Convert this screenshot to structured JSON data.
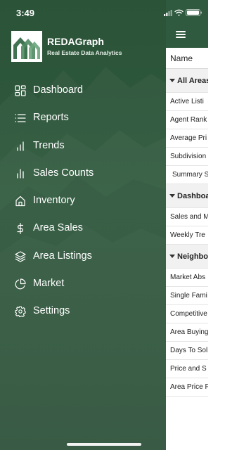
{
  "status_bar": {
    "time": "3:49"
  },
  "brand": {
    "name": "REDAGraph",
    "tagline": "Real Estate Data Analytics"
  },
  "menu": [
    {
      "label": "Dashboard",
      "icon": "dashboard-grid-icon"
    },
    {
      "label": "Reports",
      "icon": "list-icon"
    },
    {
      "label": "Trends",
      "icon": "bar-chart-icon"
    },
    {
      "label": "Sales Counts",
      "icon": "bar-chart-alt-icon"
    },
    {
      "label": "Inventory",
      "icon": "home-icon"
    },
    {
      "label": "Area Sales",
      "icon": "dollar-icon"
    },
    {
      "label": "Area Listings",
      "icon": "layers-icon"
    },
    {
      "label": "Market",
      "icon": "pie-chart-icon"
    },
    {
      "label": "Settings",
      "icon": "gear-icon"
    }
  ],
  "background_panel": {
    "column_header": "Name",
    "groups": [
      {
        "title": "All Areas",
        "rows": [
          "Active Listi",
          "Agent Rank",
          "Average Pri",
          "Subdivision",
          "Summary S"
        ]
      },
      {
        "title": "Dashboa",
        "rows": [
          "Sales and M",
          "Weekly Tre"
        ]
      },
      {
        "title": "Neighbo",
        "rows": [
          "Market Abs",
          "Single Fami",
          "Competitive",
          "Area Buying",
          "Days To Sol",
          "Price and S",
          "Area Price F"
        ]
      }
    ]
  },
  "colors": {
    "drawer_green": "#2f5a3e",
    "header_green": "#2f5a3f",
    "text_white": "#ffffff"
  }
}
